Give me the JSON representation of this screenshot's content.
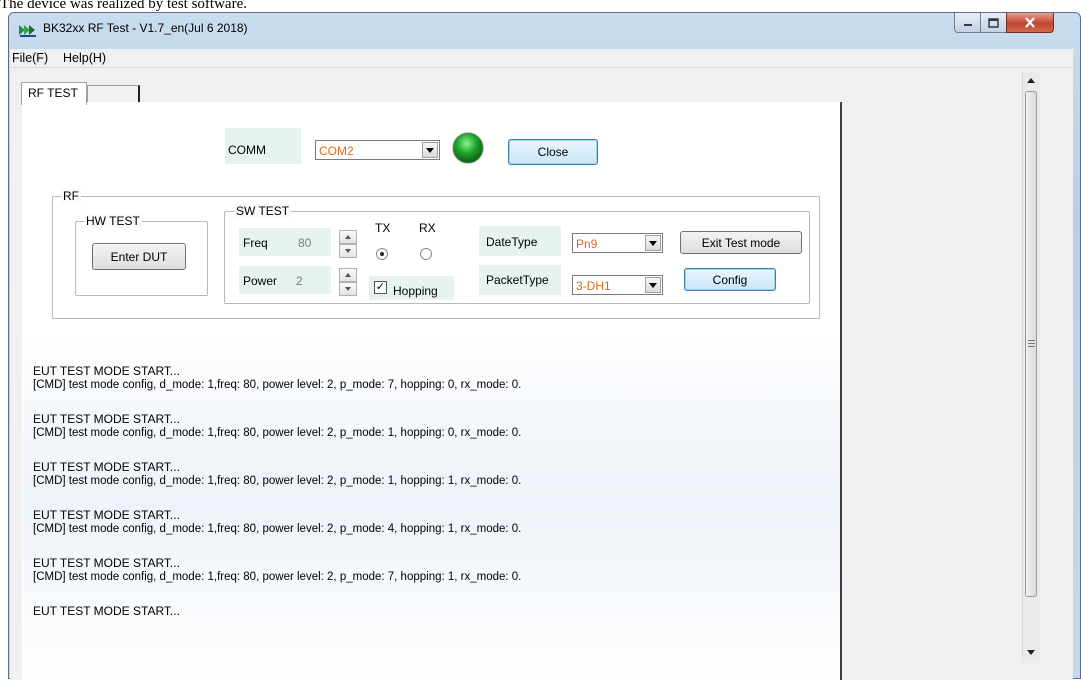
{
  "caption": "The device was realized by test software.",
  "window": {
    "title": "BK32xx RF Test - V1.7_en(Jul  6 2018)",
    "colors": {
      "close_button": "#c4452d",
      "title_bg": "#c9dcef"
    }
  },
  "menu": {
    "items": [
      "File(F)",
      "Help(H)"
    ]
  },
  "tabs": [
    {
      "label": "RF TEST",
      "active": true
    },
    {
      "label": "",
      "active": false
    }
  ],
  "comm": {
    "label": "COMM",
    "port": "COM2",
    "status": "connected",
    "status_color": "#1f9a2a",
    "close_label": "Close"
  },
  "rf": {
    "title": "RF",
    "hw_test": {
      "title": "HW TEST",
      "enter_dut_label": "Enter DUT"
    },
    "sw_test": {
      "title": "SW TEST",
      "freq_label": "Freq",
      "freq_value": "80",
      "power_label": "Power",
      "power_value": "2",
      "tx_label": "TX",
      "rx_label": "RX",
      "tx_selected": true,
      "hopping_label": "Hopping",
      "hopping_checked": true,
      "date_type_label": "DateType",
      "date_type_value": "Pn9",
      "packet_type_label": "PacketType",
      "packet_type_value": "3-DH1",
      "exit_test_label": "Exit Test mode",
      "config_label": "Config"
    }
  },
  "log": [
    {
      "head": "EUT TEST MODE START...",
      "cmd": "[CMD] test mode config, d_mode: 1,freq: 80, power level: 2, p_mode: 7, hopping: 0, rx_mode: 0."
    },
    {
      "head": "EUT TEST MODE START...",
      "cmd": "[CMD] test mode config, d_mode: 1,freq: 80, power level: 2, p_mode: 1, hopping: 0, rx_mode: 0."
    },
    {
      "head": "EUT TEST MODE START...",
      "cmd": "[CMD] test mode config, d_mode: 1,freq: 80, power level: 2, p_mode: 1, hopping: 1, rx_mode: 0."
    },
    {
      "head": "EUT TEST MODE START...",
      "cmd": "[CMD] test mode config, d_mode: 1,freq: 80, power level: 2, p_mode: 4, hopping: 1, rx_mode: 0."
    },
    {
      "head": "EUT TEST MODE START...",
      "cmd": "[CMD] test mode config, d_mode: 1,freq: 80, power level: 2, p_mode: 7, hopping: 1, rx_mode: 0."
    },
    {
      "head": "EUT TEST MODE START...",
      "cmd": ""
    }
  ]
}
